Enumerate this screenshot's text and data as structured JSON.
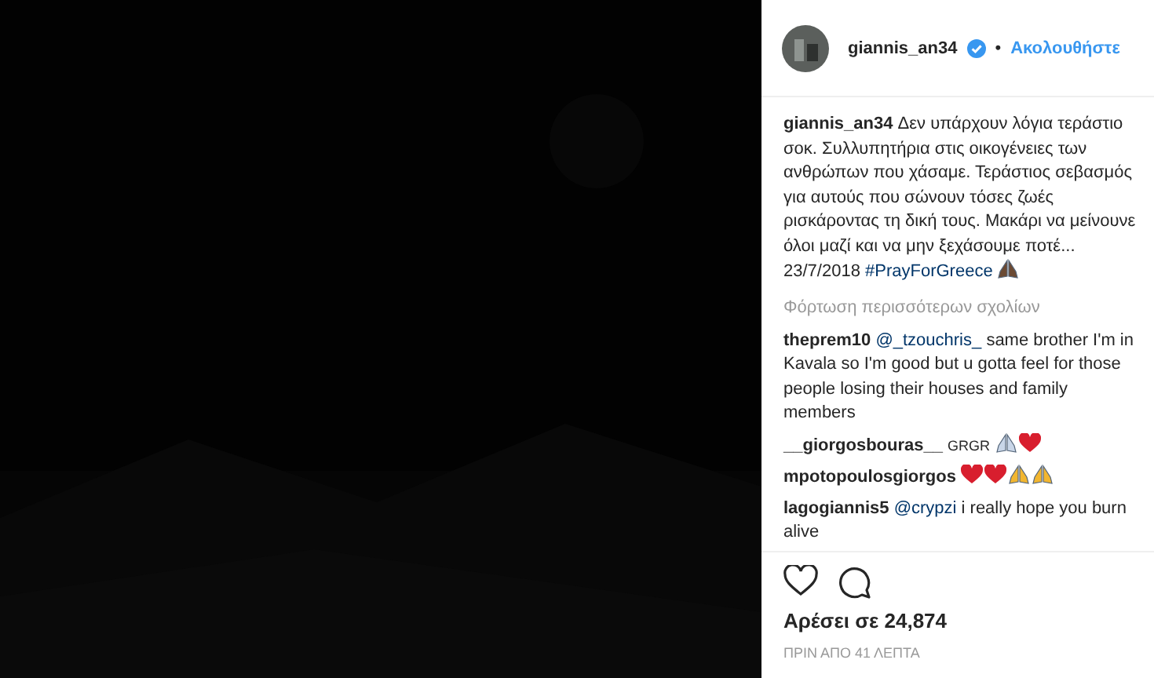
{
  "header": {
    "username": "giannis_an34",
    "verified": true,
    "separator": "•",
    "follow": "Ακολουθήστε"
  },
  "caption": {
    "username": "giannis_an34",
    "text": "Δεν υπάρχουν λόγια τεράστιο σοκ. Συλλυπητήρια στις οικογένειες των ανθρώπων που χάσαμε. Τεράστιος σεβασμός για αυτούς που σώνουν τόσες ζωές ρισκάροντας τη δική τους. Μακάρι να μείνουνε όλοι μαζί και να μην ξεχάσουμε ποτέ... 23/7/2018",
    "hashtag": "#PrayForGreece",
    "icons": [
      {
        "kind": "pray-dark"
      }
    ]
  },
  "load_more": "Φόρτωση περισσότερων σχολίων",
  "comments": [
    {
      "username": "theprem10",
      "mention": "@_tzouchris_",
      "text": "same brother I'm in Kavala so I'm good but u gotta feel for those people losing their houses and family members"
    },
    {
      "username": "__giorgosbouras__",
      "text": "GRGR",
      "small": true,
      "icons": [
        {
          "kind": "pray"
        },
        {
          "kind": "heart"
        }
      ]
    },
    {
      "username": "mpotopoulosgiorgos",
      "icons": [
        {
          "kind": "heart"
        },
        {
          "kind": "heart"
        },
        {
          "kind": "pray-gold"
        },
        {
          "kind": "pray-gold"
        }
      ]
    },
    {
      "username": "lagogiannis5",
      "mention": "@crypzi",
      "text": "i really hope you burn alive"
    }
  ],
  "likes": "Αρέσει σε 24,874",
  "time": "ΠΡΙΝ ΑΠΟ 41 ΛΕΠΤΑ"
}
